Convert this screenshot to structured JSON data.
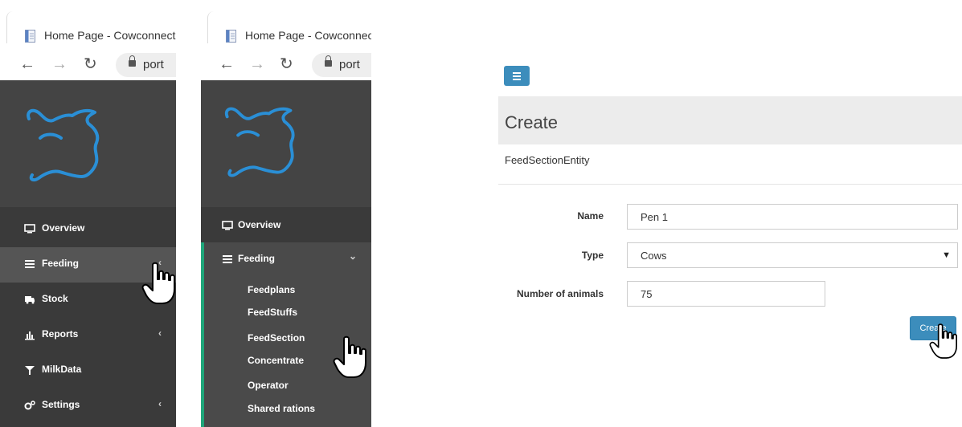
{
  "browser": {
    "tab_title": "Home Page - Cowconnect",
    "url_partial": "port"
  },
  "sidebar_collapsed": {
    "menu": [
      {
        "label": "Overview",
        "icon": "monitor-icon"
      },
      {
        "label": "Feeding",
        "icon": "list-icon",
        "chevron": "‹"
      },
      {
        "label": "Stock",
        "icon": "truck-icon"
      },
      {
        "label": "Reports",
        "icon": "bar-chart-icon",
        "chevron": "‹"
      },
      {
        "label": "MilkData",
        "icon": "filter-icon"
      },
      {
        "label": "Settings",
        "icon": "gears-icon",
        "chevron": "‹"
      }
    ]
  },
  "sidebar_expanded": {
    "menu": [
      {
        "label": "Overview",
        "icon": "monitor-icon"
      },
      {
        "label": "Feeding",
        "icon": "list-icon",
        "chevron": "⌄"
      }
    ],
    "submenu": [
      "Feedplans",
      "FeedStuffs",
      "FeedSection",
      "Concentrate",
      "Operator",
      "Shared rations"
    ]
  },
  "form": {
    "title": "Create",
    "entity": "FeedSectionEntity",
    "fields": [
      {
        "label": "Name",
        "value": "Pen 1"
      },
      {
        "label": "Type",
        "value": "Cows"
      },
      {
        "label": "Number of animals",
        "value": "75"
      }
    ],
    "submit_label": "Create"
  },
  "colors": {
    "sidebar_bg": "#3a3a3a",
    "logo_blue": "#2a8fd6",
    "accent_green": "#1fa67a",
    "button_blue": "#3c8dbc"
  }
}
